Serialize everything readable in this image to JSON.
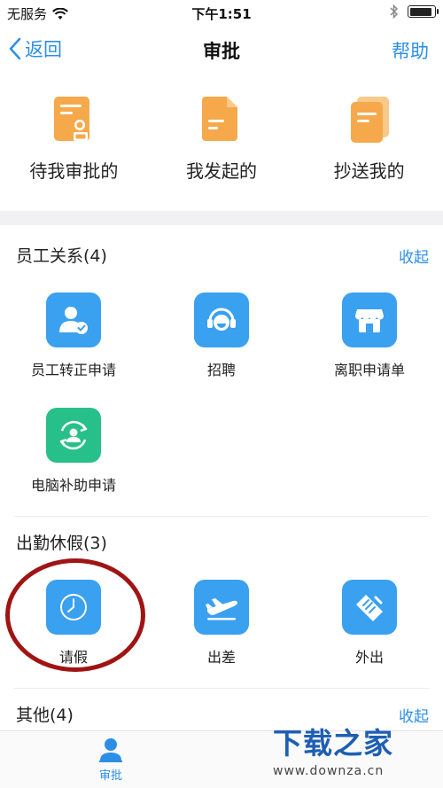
{
  "status_bar": {
    "carrier": "无服务",
    "time": "下午1:51",
    "battery_level": 0.93
  },
  "nav": {
    "back_label": "返回",
    "title": "审批",
    "help_label": "帮助"
  },
  "quick_actions": [
    {
      "label": "待我审批的",
      "icon": "approval-pending-icon"
    },
    {
      "label": "我发起的",
      "icon": "initiated-document-icon"
    },
    {
      "label": "抄送我的",
      "icon": "cc-documents-icon"
    }
  ],
  "sections": [
    {
      "title": "员工关系(4)",
      "action": "收起",
      "items": [
        {
          "label": "员工转正申请",
          "icon": "employee-regularization-icon"
        },
        {
          "label": "招聘",
          "icon": "recruitment-headset-icon"
        },
        {
          "label": "离职申请单",
          "icon": "resignation-store-icon"
        },
        {
          "label": "电脑补助申请",
          "icon": "computer-subsidy-icon"
        }
      ]
    },
    {
      "title": "出勤休假(3)",
      "items": [
        {
          "label": "请假",
          "icon": "leave-clock-icon"
        },
        {
          "label": "出差",
          "icon": "business-trip-plane-icon"
        },
        {
          "label": "外出",
          "icon": "outing-handshake-icon"
        }
      ]
    },
    {
      "title": "其他(4)",
      "action": "收起"
    }
  ],
  "tab_bar": {
    "active_tab": "审批"
  },
  "watermark": {
    "main": "下载之家",
    "sub": "www.downza.cn"
  },
  "colors": {
    "accent": "#2c8fe6",
    "tile_blue": "#3aa0f0",
    "tile_green": "#28c08a",
    "doc_orange": "#f5a94a",
    "annotation_red": "#a01414"
  }
}
